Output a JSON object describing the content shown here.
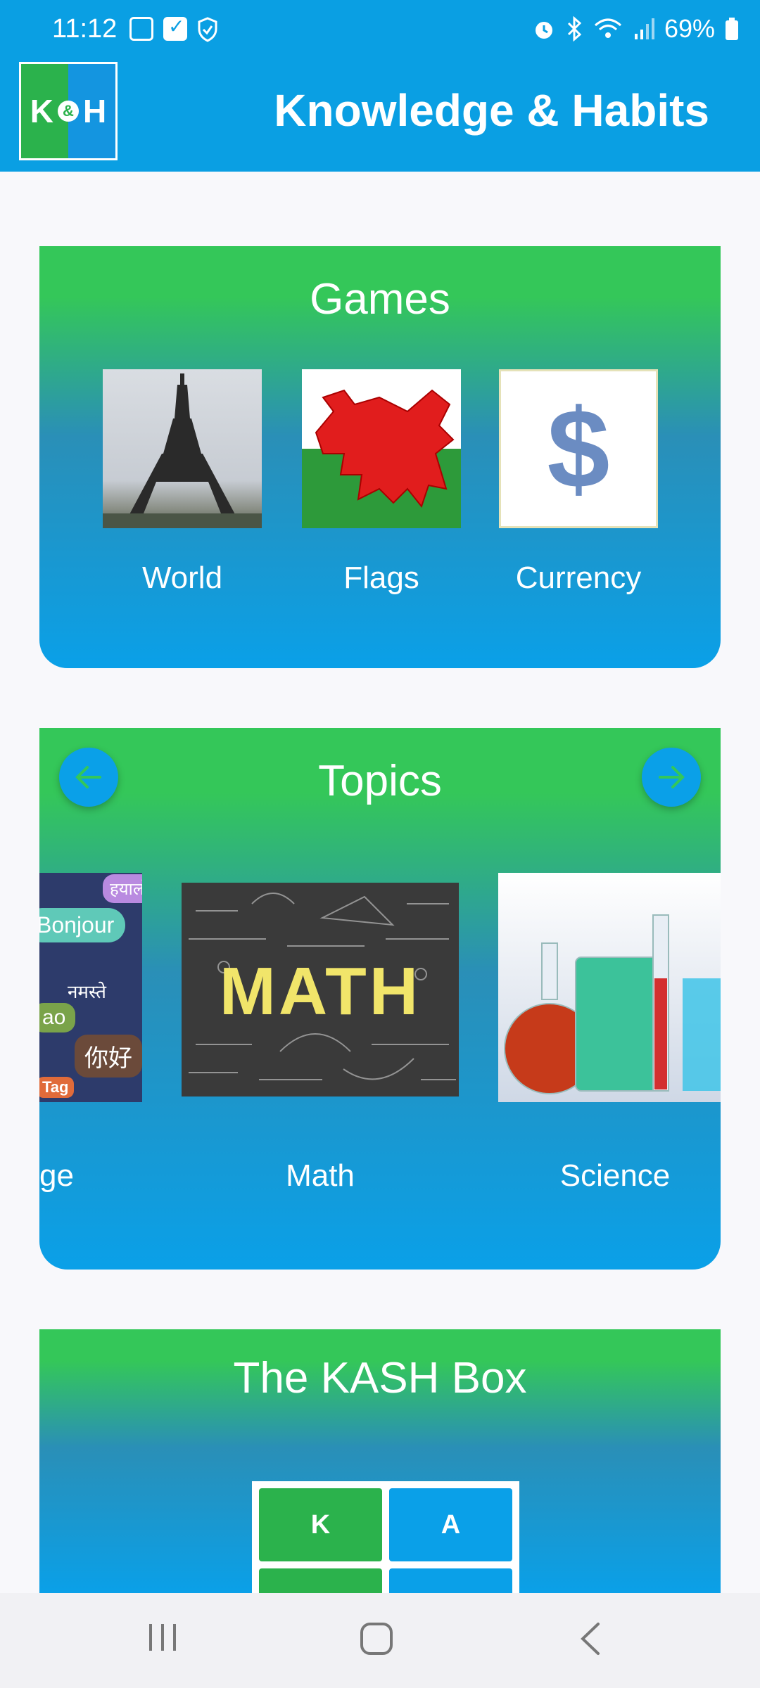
{
  "status_bar": {
    "time": "11:12",
    "battery": "69%"
  },
  "app_bar": {
    "logo_left": "K",
    "logo_amp": "&",
    "logo_right": "H",
    "title": "Knowledge & Habits"
  },
  "games": {
    "title": "Games",
    "items": [
      {
        "label": "World"
      },
      {
        "label": "Flags"
      },
      {
        "label": "Currency",
        "symbol": "$"
      }
    ]
  },
  "topics": {
    "title": "Topics",
    "items": [
      {
        "label": "ge",
        "bubbles": [
          "हयालो",
          "Bonjour",
          "नमस्ते",
          "ao",
          "你好",
          "Tag"
        ]
      },
      {
        "label": "Math",
        "image_text": "MATH"
      },
      {
        "label": "Science"
      }
    ]
  },
  "kash": {
    "title": "The KASH Box",
    "cells": [
      "K",
      "A",
      "",
      ""
    ]
  },
  "colors": {
    "app_bar": "#0a9fe3",
    "card_green": "#34c759",
    "card_blue": "#0aa0e8"
  }
}
